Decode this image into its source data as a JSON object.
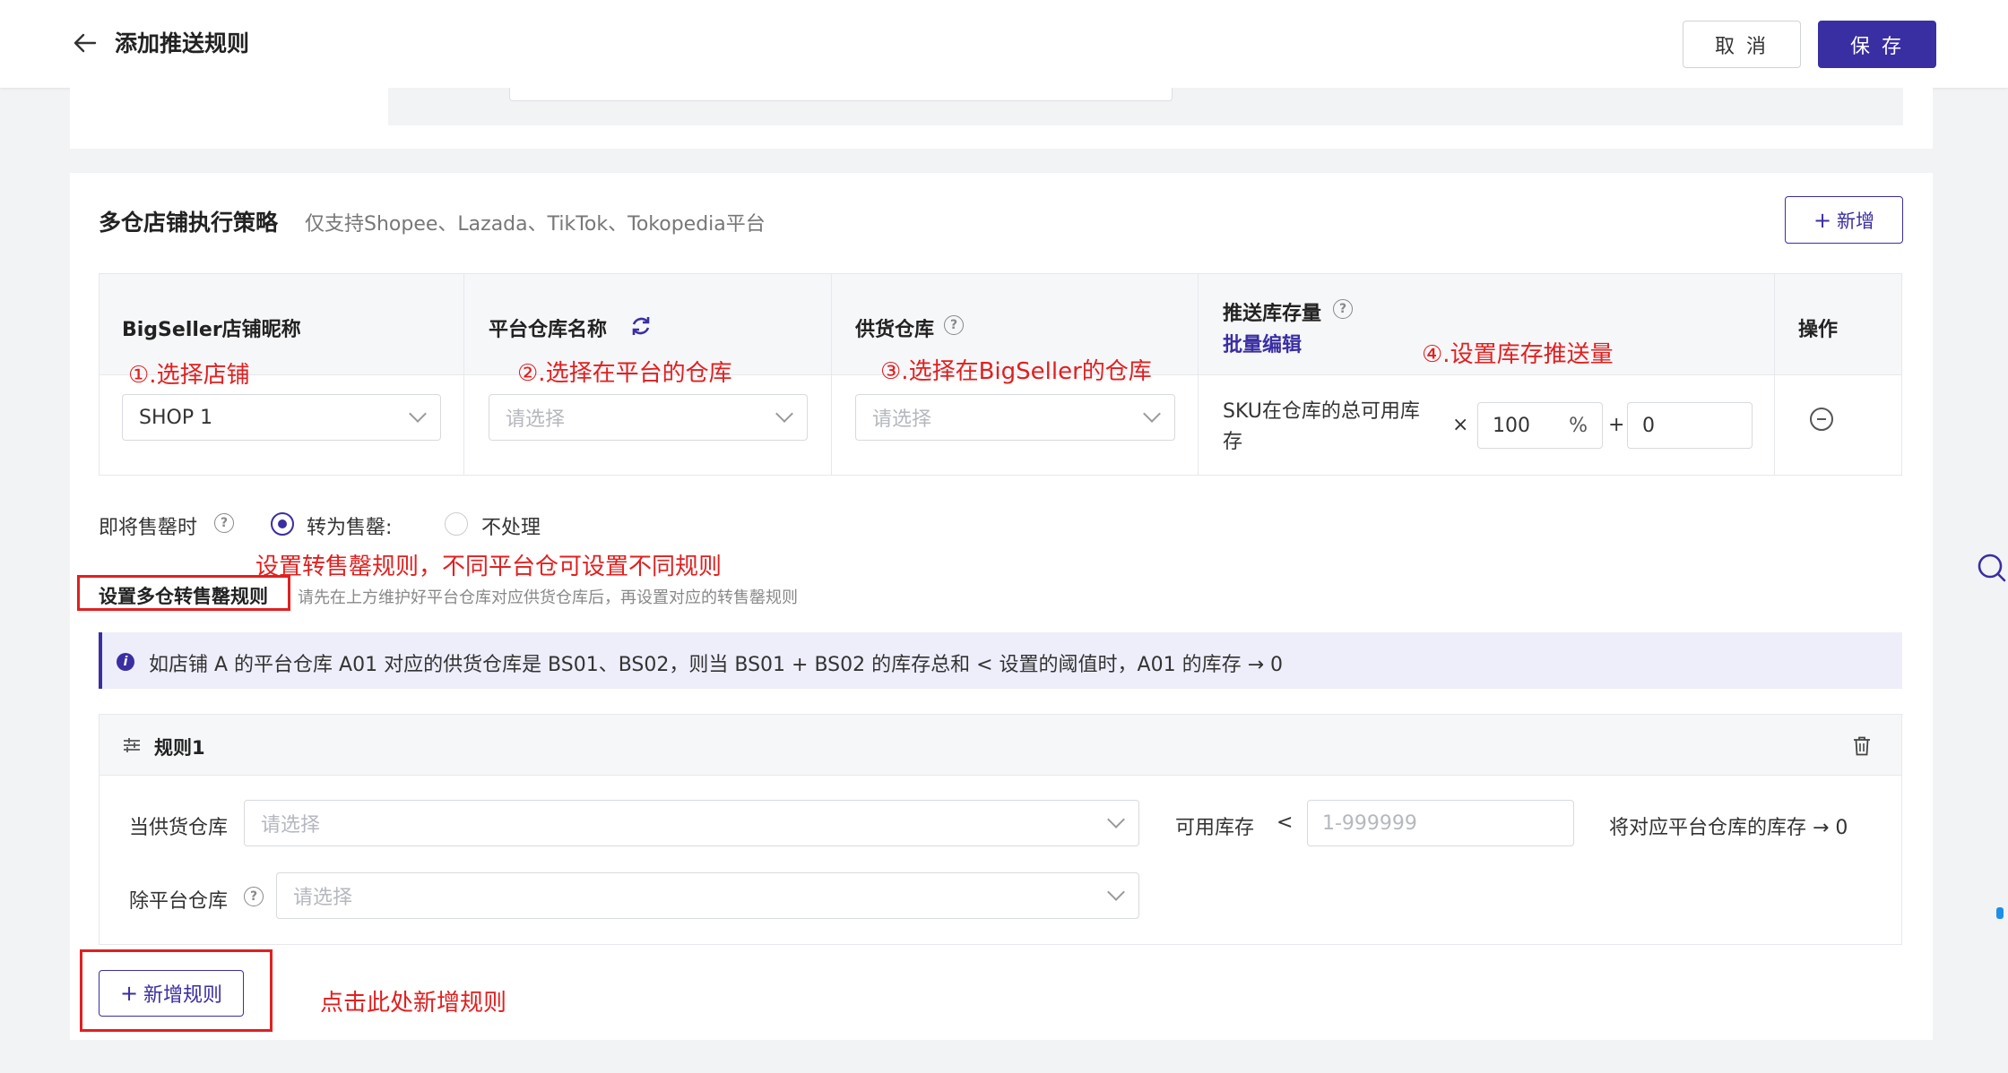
{
  "header": {
    "title": "添加推送规则",
    "cancel_label": "取 消",
    "save_label": "保 存"
  },
  "section": {
    "title": "多仓店铺执行策略",
    "subtitle": "仅支持Shopee、Lazada、TikTok、Tokopedia平台",
    "add_label": "新增"
  },
  "table": {
    "headers": {
      "shop": "BigSeller店铺昵称",
      "platform_wh": "平台仓库名称",
      "supply_wh": "供货仓库",
      "push_qty": "推送库存量",
      "action": "操作"
    },
    "batch_edit": "批量编辑",
    "row": {
      "shop_value": "SHOP 1",
      "platform_wh_placeholder": "请选择",
      "supply_wh_placeholder": "请选择",
      "push_desc": "SKU在仓库的总可用库存",
      "times": "×",
      "percent_value": "100",
      "percent_sign": "%",
      "plus": "+",
      "add_value": "0"
    }
  },
  "annotations": {
    "a1": "①.选择店铺",
    "a2": "②.选择在平台的仓库",
    "a3": "③.选择在BigSeller的仓库",
    "a4": "④.设置库存推送量",
    "a5": "设置转售罄规则，不同平台仓可设置不同规则",
    "a6": "点击此处新增规则"
  },
  "soldout": {
    "label": "即将售罄时",
    "option_on": "转为售罄:",
    "option_off": "不处理"
  },
  "multi_rule": {
    "title": "设置多仓转售罄规则",
    "hint": "请先在上方维护好平台仓库对应供货仓库后，再设置对应的转售罄规则"
  },
  "info": {
    "text": "如店铺 A 的平台仓库 A01 对应的供货仓库是 BS01、BS02，则当 BS01 + BS02 的库存总和 < 设置的阈值时，A01 的库存 → 0"
  },
  "rule1": {
    "title": "规则1",
    "supply_label": "当供货仓库",
    "supply_placeholder": "请选择",
    "stock_label": "可用库存",
    "lt": "<",
    "stock_placeholder": "1-999999",
    "result": "将对应平台仓库的库存 → 0",
    "exclude_label": "除平台仓库",
    "exclude_placeholder": "请选择"
  },
  "add_rule_label": "新增规则",
  "colors": {
    "primary": "#3a2ea3",
    "annotation": "#e02020",
    "info_bg": "#eeeefb"
  }
}
